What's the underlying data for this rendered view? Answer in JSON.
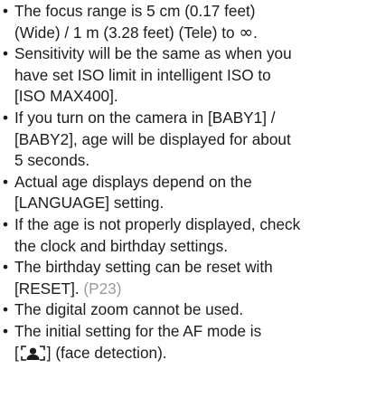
{
  "notes": [
    {
      "lines": [
        "The focus range is 5 cm (0.17 feet)",
        "(Wide) / 1 m (3.28 feet) (Tele) to"
      ],
      "infinity_symbol": "∞",
      "end_punct": "."
    },
    {
      "lines": [
        "Sensitivity will be the same as when you",
        "have set ISO limit in intelligent ISO to",
        "[ISO MAX400]."
      ]
    },
    {
      "lines": [
        "If you turn on the camera in [BABY1] /",
        "[BABY2], age will be displayed for about",
        "5 seconds."
      ]
    },
    {
      "lines": [
        "Actual age displays depend on the",
        "[LANGUAGE] setting."
      ]
    },
    {
      "lines": [
        "If the age is not properly displayed, check",
        "the clock and birthday settings."
      ]
    },
    {
      "lines": [
        "The birthday setting can be reset with",
        "[RESET]."
      ],
      "page_ref": "(P23)"
    },
    {
      "lines": [
        "The digital zoom cannot be used."
      ]
    },
    {
      "lines": [
        "The initial setting for the AF mode is"
      ],
      "icon_line": {
        "open_bracket": "[",
        "icon": "face-detection-icon",
        "close_text": "] (face detection)."
      }
    }
  ],
  "bullet_char": "•",
  "colors": {
    "text": "#1c1c1c",
    "page_ref": "#9a9a9a"
  }
}
